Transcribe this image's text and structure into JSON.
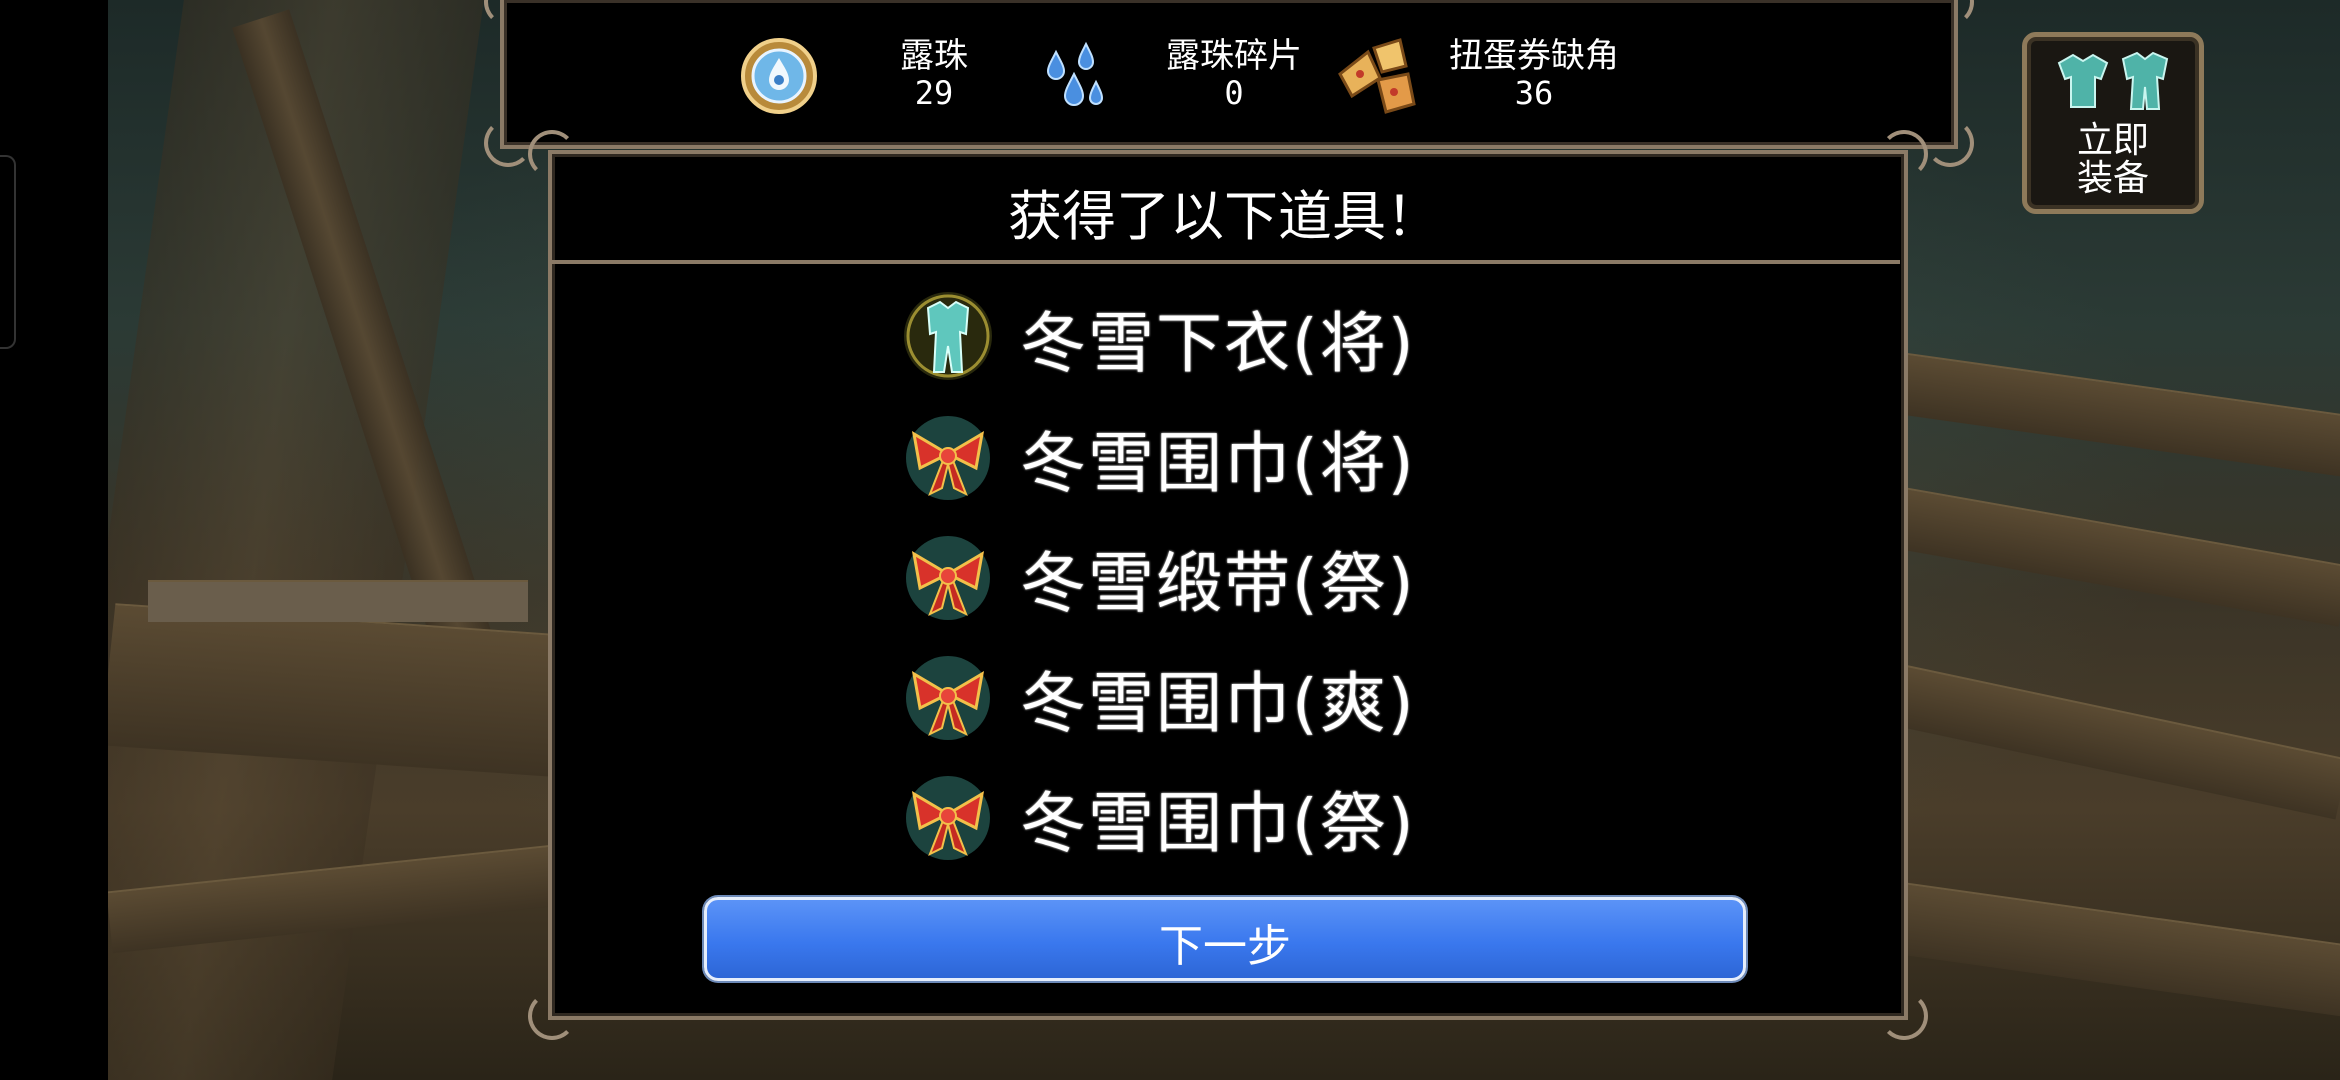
{
  "resources": [
    {
      "name": "露珠",
      "value": "29",
      "icon": "dew-orb-icon"
    },
    {
      "name": "露珠碎片",
      "value": "0",
      "icon": "dew-shard-icon"
    },
    {
      "name": "扭蛋券缺角",
      "value": "36",
      "icon": "gacha-ticket-fragment-icon"
    }
  ],
  "equip_button": {
    "line1": "立即",
    "line2": "装备",
    "icon": "armor-set-icon"
  },
  "dialog": {
    "title": "获得了以下道具！",
    "items": [
      {
        "name": "冬雪下衣(将)",
        "icon": "armor-icon"
      },
      {
        "name": "冬雪围巾(将)",
        "icon": "red-ribbon-icon"
      },
      {
        "name": "冬雪缎带(祭)",
        "icon": "red-ribbon-icon"
      },
      {
        "name": "冬雪围巾(爽)",
        "icon": "red-ribbon-icon"
      },
      {
        "name": "冬雪围巾(祭)",
        "icon": "red-ribbon-icon"
      }
    ],
    "next_label": "下一步"
  },
  "colors": {
    "frame": "#8b7a66",
    "button": "#3a78ee",
    "text": "#ffffff"
  }
}
